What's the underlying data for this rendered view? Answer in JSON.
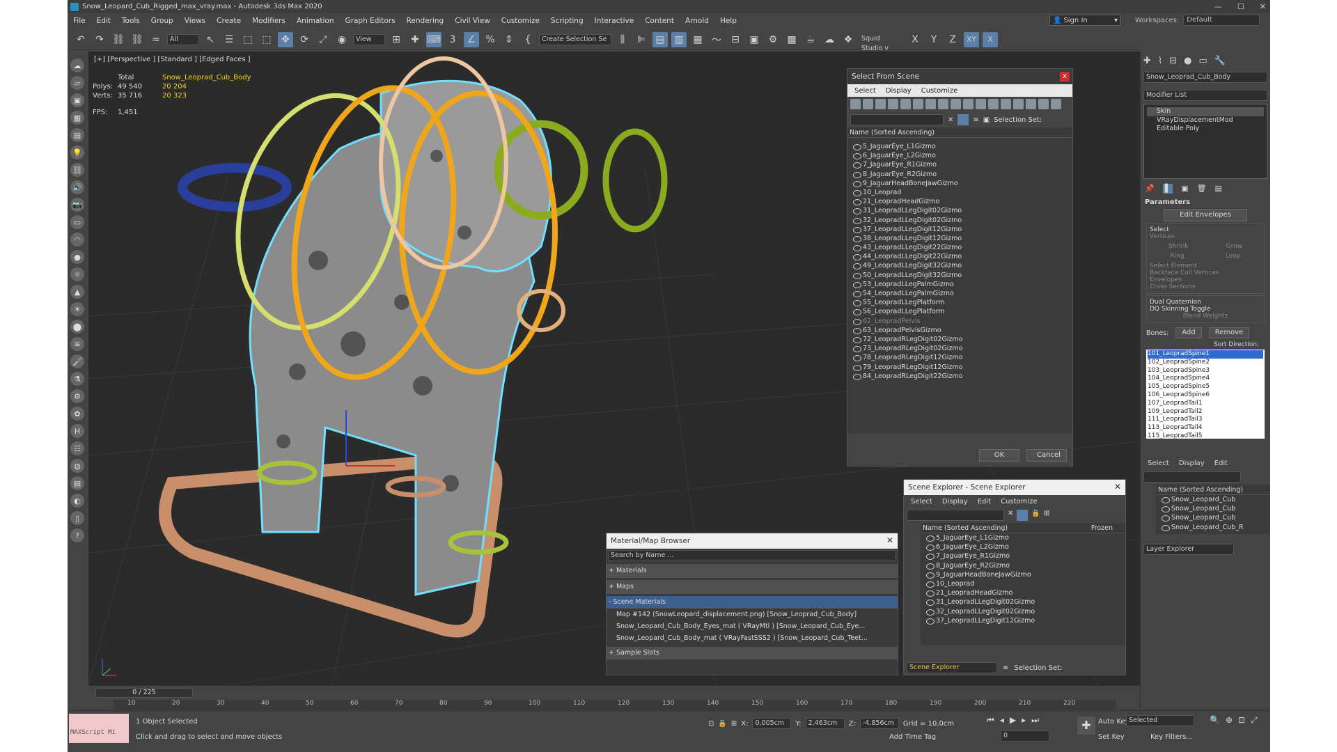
{
  "window": {
    "title": "Snow_Leopard_Cub_Rigged_max_vray.max - Autodesk 3ds Max 2020",
    "min": "—",
    "max": "☐",
    "close": "✕"
  },
  "menu": [
    "File",
    "Edit",
    "Tools",
    "Group",
    "Views",
    "Create",
    "Modifiers",
    "Animation",
    "Graph Editors",
    "Rendering",
    "Civil View",
    "Customize",
    "Scripting",
    "Interactive",
    "Content",
    "Arnold",
    "Help"
  ],
  "signin": "Sign In",
  "workspace": {
    "label": "Workspaces:",
    "value": "Default"
  },
  "toolbar": {
    "filter": "All",
    "refcoord": "View",
    "selset": "Create Selection Se",
    "studio": "Squid Studio v",
    "axes": [
      "X",
      "Y",
      "Z",
      "XY",
      "X"
    ]
  },
  "viewport": {
    "label": "[+] [Perspective ] [Standard ] [Edged Faces ]",
    "stats": {
      "col_total": "Total",
      "col_obj": "Snow_Leoprad_Cub_Body",
      "polys_label": "Polys:",
      "polys_total": "49 540",
      "polys_obj": "20 204",
      "verts_label": "Verts:",
      "verts_total": "35 716",
      "verts_obj": "20 323",
      "fps_label": "FPS:",
      "fps": "1,451"
    }
  },
  "select_from_scene": {
    "title": "Select From Scene",
    "close": "x",
    "menu": [
      "Select",
      "Display",
      "Customize"
    ],
    "selection_set": "Selection Set:",
    "header": "Name (Sorted Ascending)",
    "rows": [
      "5_JaguarEye_L1Gizmo",
      "6_JaguarEye_L2Gizmo",
      "7_JaguarEye_R1Gizmo",
      "8_JaguarEye_R2Gizmo",
      "9_JaguarHeadBoneJawGizmo",
      "10_Leoprad",
      "21_LeopradHeadGizmo",
      "31_LeopradLLegDigit02Gizmo",
      "32_LeopradLLegDigit02Gizmo",
      "37_LeopradLLegDigit12Gizmo",
      "38_LeopradLLegDigit12Gizmo",
      "43_LeopradLLegDigit22Gizmo",
      "44_LeopradLLegDigit22Gizmo",
      "49_LeopradLLegDigit32Gizmo",
      "50_LeopradLLegDigit32Gizmo",
      "53_LeopradLLegPalmGizmo",
      "54_LeopradLLegPalmGizmo",
      "55_LeopradLLegPlatform",
      "56_LeopradLLegPlatform",
      "62_LeopradPelvis",
      "63_LeopradPelvisGizmo",
      "72_LeopradRLegDigit02Gizmo",
      "73_LeopradRLegDigit02Gizmo",
      "78_LeopradRLegDigit12Gizmo",
      "79_LeopradRLegDigit12Gizmo",
      "84_LeopradRLegDigit22Gizmo"
    ],
    "ok": "OK",
    "cancel": "Cancel"
  },
  "material_browser": {
    "title": "Material/Map Browser",
    "search_placeholder": "Search by Name ...",
    "sections": [
      "+ Materials",
      "+ Maps",
      "- Scene Materials"
    ],
    "items": [
      "Map #142 (SnowLeopard_displacement.png) [Snow_Leoprad_Cub_Body]",
      "Snow_Leopard_Cub_Body_Eyes_mat ( VRayMtl ) [Snow_Leopard_Cub_Eye...",
      "Snow_Leopard_Cub_Body_mat ( VRayFastSSS2 ) [Snow_Leopard_Cub_Teet..."
    ],
    "footer": "+ Sample Slots"
  },
  "scene_explorer": {
    "title": "Scene Explorer - Scene Explorer",
    "menu": [
      "Select",
      "Display",
      "Edit",
      "Customize"
    ],
    "header": "Name (Sorted Ascending)",
    "frozen": "Frozen",
    "rows": [
      "5_JaguarEye_L1Gizmo",
      "6_JaguarEye_L2Gizmo",
      "7_JaguarEye_R1Gizmo",
      "8_JaguarEye_R2Gizmo",
      "9_JaguarHeadBoneJawGizmo",
      "10_Leoprad",
      "21_LeopradHeadGizmo",
      "31_LeopradLLegDigit02Gizmo",
      "32_LeopradLLegDigit02Gizmo",
      "37_LeopradLLegDigit12Gizmo"
    ],
    "footer_name": "Scene Explorer",
    "selection_set": "Selection Set:"
  },
  "cmd_panel": {
    "object_name": "Snow_Leoprad_Cub_Body",
    "modifier_list": "Modifier List",
    "stack": [
      "Skin",
      "VRayDisplacementMod",
      "Editable Poly"
    ],
    "parameters": "Parameters",
    "edit_envelopes": "Edit Envelopes",
    "select": "Select",
    "opts": [
      "Vertices",
      "Shrink",
      "Grow",
      "Ring",
      "Loop",
      "Select Element",
      "Backface Cull Vertices",
      "Envelopes",
      "Cross Sections"
    ],
    "dual_q": "Dual Quaternion",
    "dq_toggle": "DQ Skinning Toggle",
    "blend_weights": "Blend Weights",
    "bones_label": "Bones:",
    "add": "Add",
    "remove": "Remove",
    "sort_dir": "Sort Direction:",
    "bones": [
      "101_LeopradSpine1",
      "102_LeopradSpine2",
      "103_LeopradSpine3",
      "104_LeopradSpine4",
      "105_LeopradSpine5",
      "106_LeopradSpine6",
      "107_LeopradTail1",
      "109_LeopradTail2",
      "111_LeopradTail3",
      "113_LeopradTail4",
      "115_LeopradTail5"
    ]
  },
  "layer_explorer": {
    "menu": [
      "Select",
      "Display",
      "Edit"
    ],
    "header": "Name (Sorted Ascending)",
    "rows": [
      "Snow_Leopard_Cub",
      "Snow_Leopard_Cub",
      "Snow_Leopard_Cub",
      "Snow_Leopard_Cub_R"
    ],
    "footer": "Layer Explorer"
  },
  "timeline": {
    "slider": "0 / 225",
    "ticks": [
      "10",
      "20",
      "30",
      "40",
      "50",
      "60",
      "70",
      "80",
      "90",
      "100",
      "110",
      "120",
      "130",
      "140",
      "150",
      "160",
      "170",
      "180",
      "190",
      "200",
      "210",
      "220"
    ]
  },
  "status": {
    "script": "MAXScript Mi",
    "selected": "1 Object Selected",
    "prompt": "Click and drag to select and move objects",
    "x": "0,005cm",
    "y": "2,463cm",
    "z": "-4,856cm",
    "grid": "Grid = 10,0cm",
    "add_tag": "Add Time Tag",
    "autokey": "Auto Key",
    "selected_dd": "Selected",
    "setkey": "Set Key",
    "keyfilters": "Key Filters...",
    "frame": "0"
  }
}
